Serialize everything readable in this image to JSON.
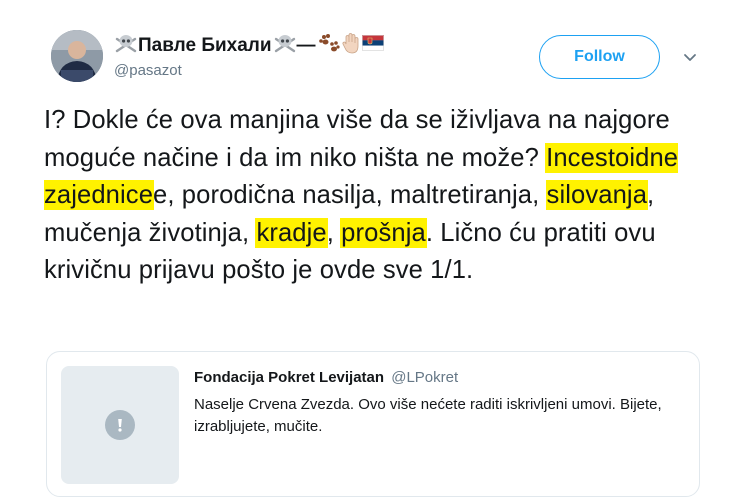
{
  "tweet": {
    "author": {
      "name": "Павле Бихали",
      "name_suffix": "—",
      "handle": "@pasazot",
      "avatar_alt": "profile photo"
    },
    "follow_label": "Follow",
    "text_segments": [
      {
        "text": "I? Dokle će ova manjina više da se iživljava na najgore moguće načine i da im niko ništa ne može? "
      },
      {
        "text": "Incestoidne zajednice",
        "highlight": true
      },
      {
        "text": "e, porodična nasilja, maltretiranja, "
      },
      {
        "text": "silovanja",
        "highlight": true
      },
      {
        "text": ", mučenja životinja, "
      },
      {
        "text": "kradje",
        "highlight": true
      },
      {
        "text": ", "
      },
      {
        "text": "prošnja",
        "highlight": true
      },
      {
        "text": ". Lično ću pratiti ovu krivičnu prijavu pošto je ovde sve 1/1."
      }
    ]
  },
  "quoted_tweet": {
    "author": "Fondacija Pokret Levijatan",
    "handle": "@LPokret",
    "text": "Naselje Crvena Zvezda. Ovo više nećete raditi iskrivljeni umovi. Bijete, izrabljujete, mučite.",
    "media_icon": "exclamation-icon"
  },
  "colors": {
    "accent": "#1da1f2",
    "highlight": "#fff200",
    "text": "#14171a",
    "muted": "#657786",
    "card_border": "#e1e8ed"
  }
}
